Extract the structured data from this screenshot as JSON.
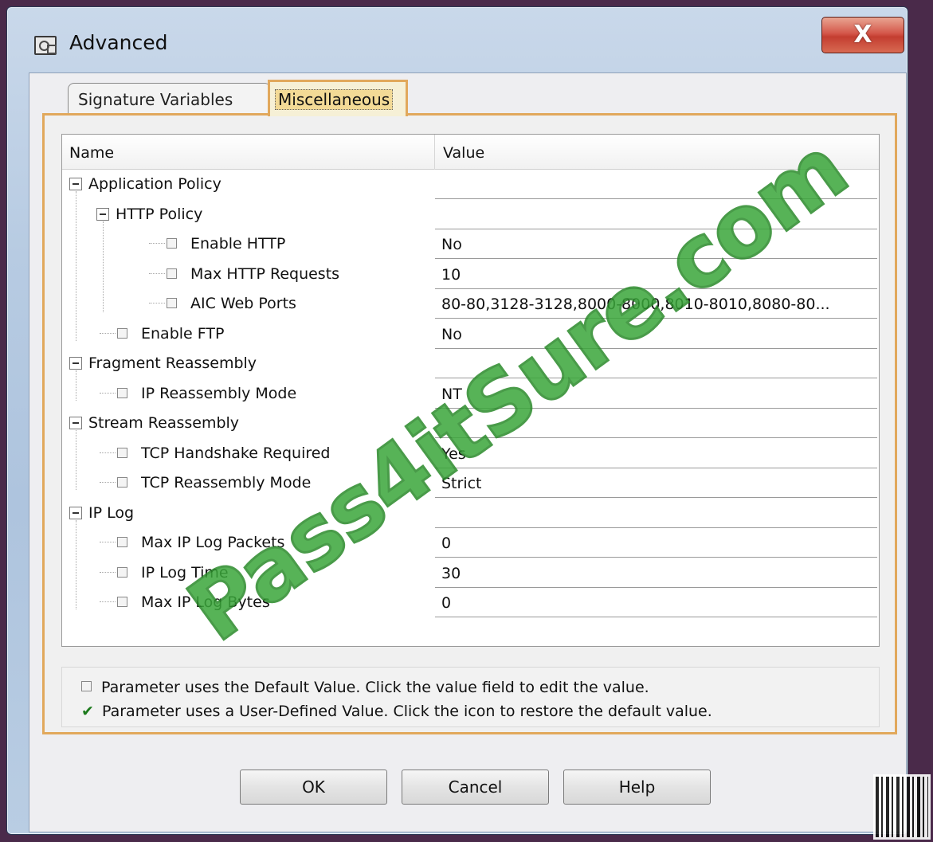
{
  "window": {
    "title": "Advanced",
    "close_glyph": "X"
  },
  "tabs": [
    {
      "label": "Signature Variables",
      "active": false
    },
    {
      "label": "Miscellaneous",
      "active": true
    }
  ],
  "grid": {
    "columns": [
      "Name",
      "Value"
    ],
    "rows": [
      {
        "name": "Application Policy",
        "value": "",
        "kind": "group",
        "level": 0
      },
      {
        "name": "HTTP Policy",
        "value": "",
        "kind": "group",
        "level": 1
      },
      {
        "name": "Enable HTTP",
        "value": "No",
        "kind": "leaf",
        "level": 2
      },
      {
        "name": "Max HTTP Requests",
        "value": "10",
        "kind": "leaf",
        "level": 2
      },
      {
        "name": "AIC Web Ports",
        "value": "80-80,3128-3128,8000-8000,8010-8010,8080-80...",
        "kind": "leaf",
        "level": 2
      },
      {
        "name": "Enable FTP",
        "value": "No",
        "kind": "leaf",
        "level": 1
      },
      {
        "name": "Fragment Reassembly",
        "value": "",
        "kind": "group",
        "level": 0
      },
      {
        "name": "IP Reassembly Mode",
        "value": "NT",
        "kind": "leaf",
        "level": 1
      },
      {
        "name": "Stream Reassembly",
        "value": "",
        "kind": "group",
        "level": 0
      },
      {
        "name": "TCP Handshake Required",
        "value": "Yes",
        "kind": "leaf",
        "level": 1
      },
      {
        "name": "TCP Reassembly Mode",
        "value": "Strict",
        "kind": "leaf",
        "level": 1
      },
      {
        "name": "IP Log",
        "value": "",
        "kind": "group",
        "level": 0
      },
      {
        "name": "Max IP Log Packets",
        "value": "0",
        "kind": "leaf",
        "level": 1
      },
      {
        "name": "IP Log Time",
        "value": "30",
        "kind": "leaf",
        "level": 1
      },
      {
        "name": "Max IP Log Bytes",
        "value": "0",
        "kind": "leaf",
        "level": 1
      }
    ]
  },
  "legend": {
    "default_text": "Parameter uses the Default Value.  Click the value field to edit the value.",
    "user_text": "Parameter uses a User-Defined Value.  Click the icon to restore the default value."
  },
  "buttons": {
    "ok": "OK",
    "cancel": "Cancel",
    "help": "Help"
  },
  "watermark": "Pass4itSure.com",
  "icons": {
    "app": "advanced-settings-icon",
    "expander": "collapse-minus-icon",
    "leaf": "default-value-icon",
    "user_defined": "checkmark-icon"
  },
  "colors": {
    "tab_accent": "#e1a85c",
    "close_button": "#c33d30",
    "watermark": "#3aa63a",
    "checkmark": "#1c7a1c"
  }
}
